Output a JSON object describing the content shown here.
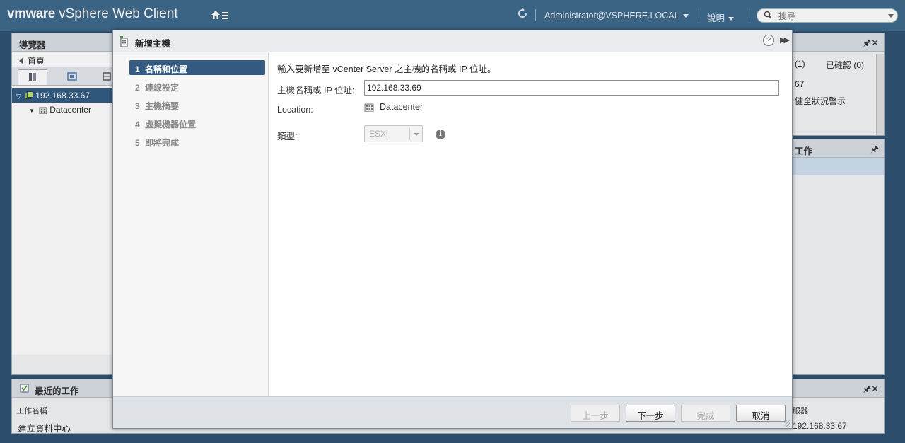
{
  "topbar": {
    "brand_vm": "vmware",
    "brand_rest": "vSphere Web Client",
    "home_icon": "home-icon",
    "refresh_icon": "refresh-icon",
    "user": "Administrator@VSPHERE.LOCAL",
    "help": "說明",
    "search_placeholder": "搜尋"
  },
  "navigator": {
    "title": "導覽器",
    "back_label": "首頁",
    "tree": [
      {
        "label": "192.168.33.67",
        "selected": true
      },
      {
        "label": "Datacenter",
        "selected": false
      }
    ]
  },
  "right_panels": {
    "top_col_a": "(1)",
    "top_col_b": "已確認 (0)",
    "top_row1": "67",
    "top_row2": "健全狀況警示",
    "mid_title": "工作"
  },
  "recent_tasks": {
    "title": "最近的工作",
    "col_task_name": "工作名稱",
    "col_server": "服器",
    "row_task": "建立資料中心",
    "row_server": "192.168.33.67"
  },
  "dialog": {
    "title": "新增主機",
    "help": "?",
    "steps": [
      {
        "num": "1",
        "label": "名稱和位置",
        "active": true
      },
      {
        "num": "2",
        "label": "連線設定",
        "active": false
      },
      {
        "num": "3",
        "label": "主機摘要",
        "active": false
      },
      {
        "num": "4",
        "label": "虛擬機器位置",
        "active": false
      },
      {
        "num": "5",
        "label": "即將完成",
        "active": false
      }
    ],
    "intro": "輸入要新增至 vCenter Server 之主機的名稱或 IP 位址。",
    "host_label": "主機名稱或 IP 位址:",
    "host_value": "192.168.33.69",
    "location_label": "Location:",
    "location_value": "Datacenter",
    "type_label": "類型:",
    "type_value": "ESXi",
    "buttons": {
      "back": "上一步",
      "next": "下一步",
      "finish": "完成",
      "cancel": "取消"
    }
  },
  "colors": {
    "topbar": "#3b6688",
    "step_active": "#345a82",
    "tree_selected": "#2e5a80"
  }
}
